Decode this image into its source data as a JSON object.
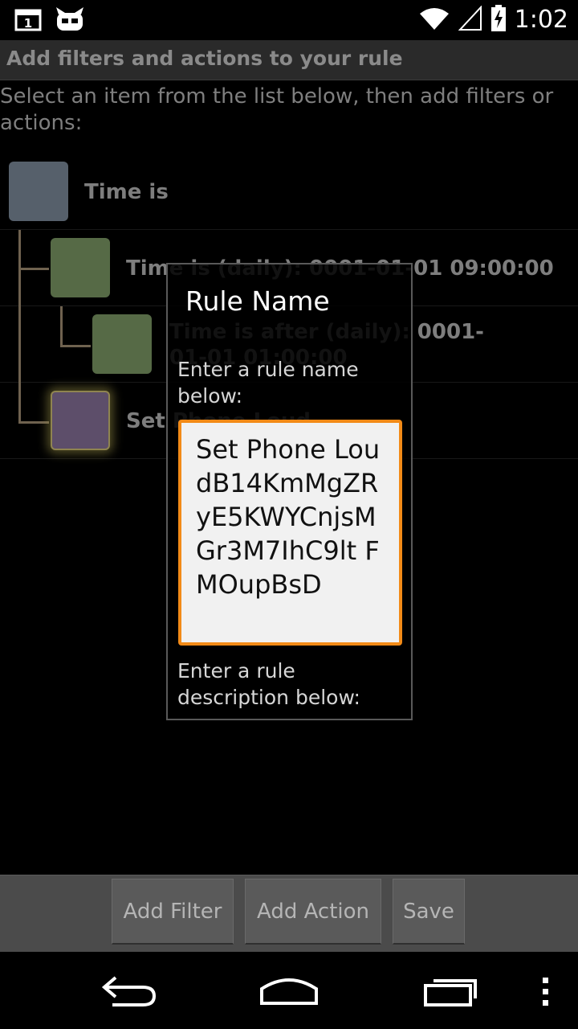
{
  "status_bar": {
    "notification_badge": "1",
    "time": "1:02"
  },
  "header": {
    "title": "Add filters and actions to your rule"
  },
  "instruction": "Select an item from the list below, then add filters or actions:",
  "tree": {
    "items": [
      {
        "label": "Time is",
        "color": "#56606b",
        "level": 0
      },
      {
        "label": "Time is (daily): 0001-01-01 09:00:00",
        "color": "#566a46",
        "level": 1
      },
      {
        "label": "Time is after (daily): 0001-01-01 01:00:00",
        "color": "#566a46",
        "level": 2
      },
      {
        "label": "Set Phone Loud",
        "color": "#5d4e6a",
        "level": 1,
        "selected": true
      }
    ]
  },
  "dialog": {
    "title": "Rule Name",
    "name_prompt": "Enter a rule name below:",
    "name_value": "Set Phone LoudB14KmMgZRyE5KWYCnjsMGr3M7IhC9lt FMOupBsD",
    "description_prompt": "Enter a rule description below:"
  },
  "actions": {
    "add_filter": "Add Filter",
    "add_action": "Add Action",
    "save": "Save"
  },
  "colors": {
    "focus_accent": "#f28a17",
    "connector": "#6f624f"
  }
}
